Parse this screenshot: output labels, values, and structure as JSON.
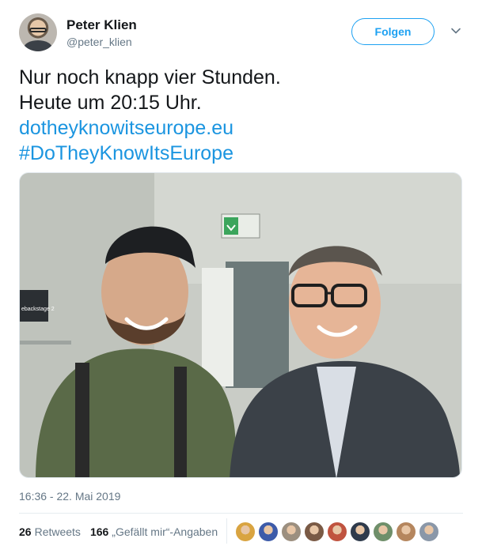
{
  "user": {
    "name": "Peter Klien",
    "handle": "@peter_klien",
    "follow_label": "Folgen"
  },
  "tweet": {
    "lines": [
      "Nur noch knapp vier Stunden.",
      "Heute um 20:15 Uhr."
    ],
    "link": "dotheyknowitseurope.eu",
    "hashtag": "#DoTheyKnowItsEurope",
    "photo_sign": "ebackstage 2",
    "timestamp": "16:36 - 22. Mai 2019"
  },
  "stats": {
    "retweets_count": "26",
    "retweets_label": "Retweets",
    "likes_count": "166",
    "likes_label": "„Gefällt mir“-Angaben"
  },
  "likers": [
    {
      "name": "liker-1",
      "color": "#d9a441"
    },
    {
      "name": "liker-2",
      "color": "#3d5ba9"
    },
    {
      "name": "liker-3",
      "color": "#9c8f7f"
    },
    {
      "name": "liker-4",
      "color": "#7a5a45"
    },
    {
      "name": "liker-5",
      "color": "#c0533f"
    },
    {
      "name": "liker-6",
      "color": "#2f3b4c"
    },
    {
      "name": "liker-7",
      "color": "#6f8f6a"
    },
    {
      "name": "liker-8",
      "color": "#b5865e"
    },
    {
      "name": "liker-9",
      "color": "#8a97a8"
    }
  ],
  "colors": {
    "accent": "#1da1f2",
    "link": "#1b95e0",
    "muted": "#657786"
  }
}
